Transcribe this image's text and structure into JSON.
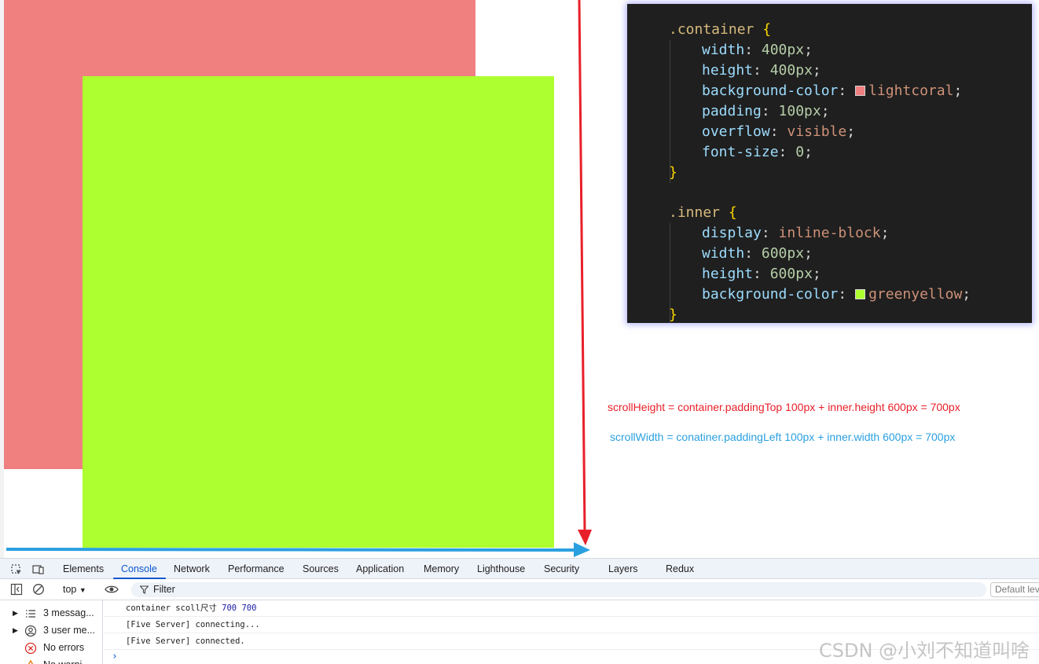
{
  "code": {
    "lines": [
      {
        "selector": ".container",
        "open": " {"
      },
      {
        "prop": "width",
        "value": "400px"
      },
      {
        "prop": "height",
        "value": "400px"
      },
      {
        "prop": "background-color",
        "value": "lightcoral",
        "swatch": "#f08080"
      },
      {
        "prop": "padding",
        "value": "100px"
      },
      {
        "prop": "overflow",
        "value": "visible"
      },
      {
        "prop": "font-size",
        "value": "0"
      },
      {
        "close": "}"
      },
      {
        "selector": ".inner",
        "open": " {"
      },
      {
        "prop": "display",
        "value": "inline-block"
      },
      {
        "prop": "width",
        "value": "600px"
      },
      {
        "prop": "height",
        "value": "600px"
      },
      {
        "prop": "background-color",
        "value": "greenyellow",
        "swatch": "#adff2f"
      },
      {
        "close": "}"
      }
    ]
  },
  "annotations": {
    "scroll_height": "scrollHeight = container.paddingTop 100px + inner.height 600px = 700px",
    "scroll_width": "scrollWidth = conatiner.paddingLeft 100px + inner.width 600px = 700px"
  },
  "colors": {
    "container": "#f08080",
    "inner": "#adff2f",
    "height_arrow": "#e8202a",
    "width_arrow": "#2aa0e0"
  },
  "devtools": {
    "tabs": [
      "Elements",
      "Console",
      "Network",
      "Performance",
      "Sources",
      "Application",
      "Memory",
      "Lighthouse",
      "Security",
      "Layers",
      "Redux"
    ],
    "active_tab": "Console",
    "toolbar": {
      "context": "top",
      "filter_placeholder": "Filter",
      "levels": "Default levels"
    },
    "sidebar": [
      {
        "label": "3 messag...",
        "icon": "list-icon"
      },
      {
        "label": "3 user me...",
        "icon": "user-icon"
      },
      {
        "label": "No errors",
        "icon": "error-icon"
      },
      {
        "label": "No warni...",
        "icon": "warning-icon"
      }
    ],
    "logs": [
      {
        "text": "container scoll尺寸 ",
        "n1": "700",
        "n2": "700"
      },
      {
        "text": "[Five Server] connecting..."
      },
      {
        "text": "[Five Server] connected."
      }
    ],
    "prompt": "›"
  },
  "watermark": "CSDN @小刘不知道叫啥"
}
